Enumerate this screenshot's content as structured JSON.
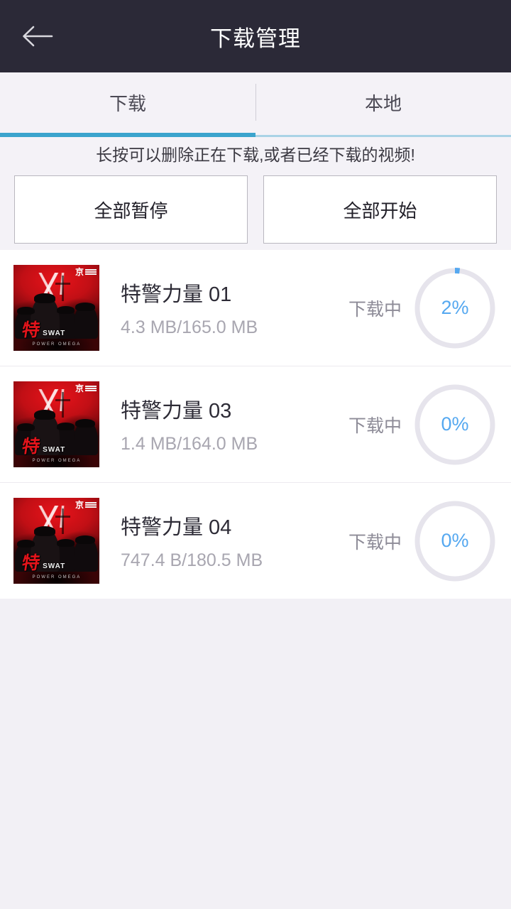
{
  "header": {
    "title": "下载管理",
    "back_icon": "arrow-left-icon"
  },
  "tabs": [
    {
      "label": "下载",
      "active": true
    },
    {
      "label": "本地",
      "active": false
    }
  ],
  "hint": "长按可以删除正在下载,或者已经下载的视频!",
  "actions": {
    "pause_all": "全部暂停",
    "start_all": "全部开始"
  },
  "downloads": [
    {
      "title": "特警力量 01",
      "size": "4.3 MB/165.0 MB",
      "status": "下载中",
      "percent": "2%",
      "progress": 2,
      "poster": {
        "title_cn": "特",
        "title_en": "SWAT",
        "sub_en": "POWER  OMEGA",
        "brand": "京"
      }
    },
    {
      "title": "特警力量 03",
      "size": "1.4 MB/164.0 MB",
      "status": "下载中",
      "percent": "0%",
      "progress": 0,
      "poster": {
        "title_cn": "特",
        "title_en": "SWAT",
        "sub_en": "POWER  OMEGA",
        "brand": "京"
      }
    },
    {
      "title": "特警力量 04",
      "size": "747.4 B/180.5 MB",
      "status": "下载中",
      "percent": "0%",
      "progress": 0,
      "poster": {
        "title_cn": "特",
        "title_en": "SWAT",
        "sub_en": "POWER  OMEGA",
        "brand": "京"
      }
    }
  ],
  "colors": {
    "appbar_bg": "#2b2937",
    "accent_blue": "#3ba4cd",
    "progress_blue": "#55a8f0",
    "page_bg": "#f2f0f5",
    "ring_track": "#e6e4ec"
  }
}
